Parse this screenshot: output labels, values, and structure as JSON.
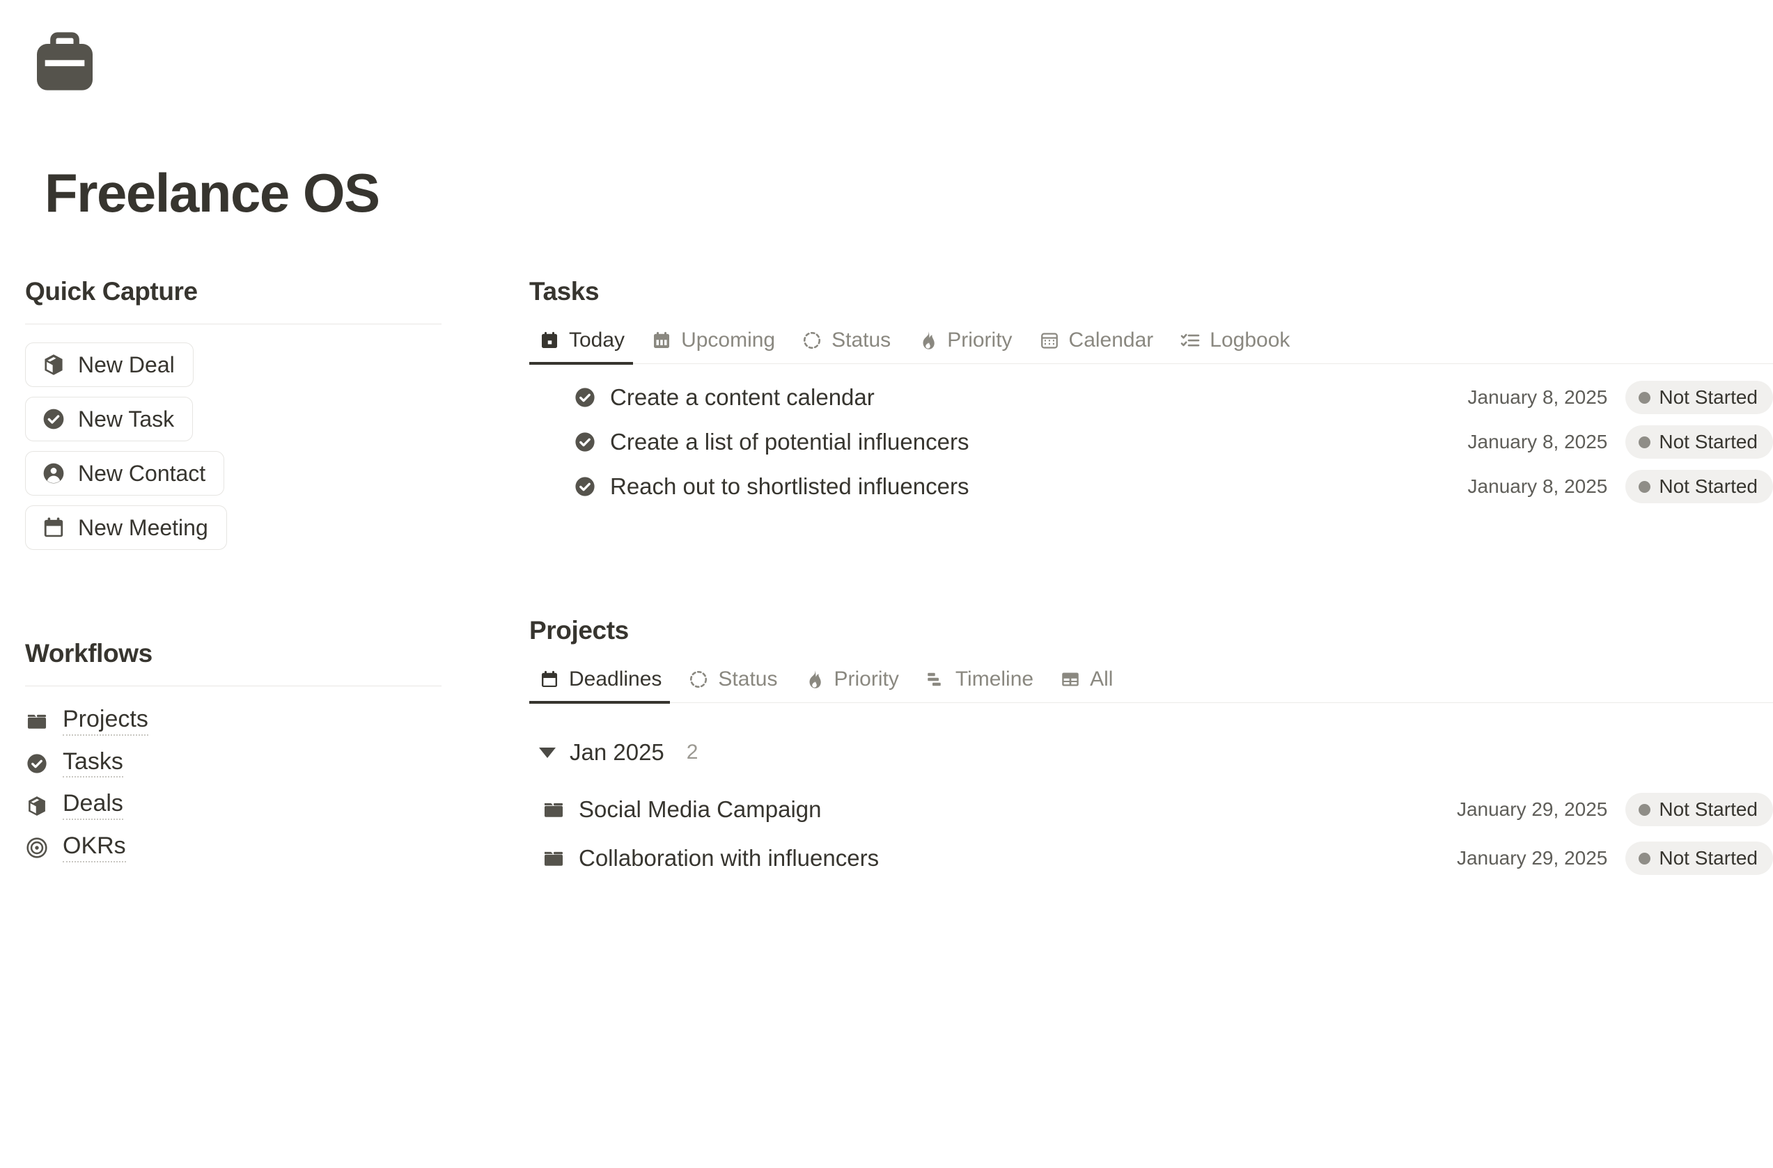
{
  "header": {
    "icon": "briefcase-icon",
    "title": "Freelance OS"
  },
  "quick_capture": {
    "heading": "Quick Capture",
    "buttons": [
      {
        "label": "New Deal",
        "icon": "package-icon"
      },
      {
        "label": "New Task",
        "icon": "check-circle-icon"
      },
      {
        "label": "New Contact",
        "icon": "person-circle-icon"
      },
      {
        "label": "New Meeting",
        "icon": "calendar-icon"
      }
    ]
  },
  "workflows": {
    "heading": "Workflows",
    "items": [
      {
        "label": "Projects",
        "icon": "folder-icon"
      },
      {
        "label": "Tasks",
        "icon": "check-circle-icon"
      },
      {
        "label": "Deals",
        "icon": "package-icon"
      },
      {
        "label": "OKRs",
        "icon": "target-icon"
      }
    ]
  },
  "tasks": {
    "heading": "Tasks",
    "tabs": [
      {
        "label": "Today",
        "icon": "calendar-today-icon",
        "active": true
      },
      {
        "label": "Upcoming",
        "icon": "calendar-upcoming-icon",
        "active": false
      },
      {
        "label": "Status",
        "icon": "dashed-circle-icon",
        "active": false
      },
      {
        "label": "Priority",
        "icon": "flame-icon",
        "active": false
      },
      {
        "label": "Calendar",
        "icon": "calendar-grid-icon",
        "active": false
      },
      {
        "label": "Logbook",
        "icon": "checklist-icon",
        "active": false
      }
    ],
    "rows": [
      {
        "title": "Create a content calendar",
        "icon": "check-circle-icon",
        "date": "January 8, 2025",
        "status": "Not Started"
      },
      {
        "title": "Create a list of potential influencers",
        "icon": "check-circle-icon",
        "date": "January 8, 2025",
        "status": "Not Started"
      },
      {
        "title": "Reach out to shortlisted influencers",
        "icon": "check-circle-icon",
        "date": "January 8, 2025",
        "status": "Not Started"
      }
    ]
  },
  "projects": {
    "heading": "Projects",
    "tabs": [
      {
        "label": "Deadlines",
        "icon": "calendar-icon",
        "active": true
      },
      {
        "label": "Status",
        "icon": "dashed-circle-icon",
        "active": false
      },
      {
        "label": "Priority",
        "icon": "flame-icon",
        "active": false
      },
      {
        "label": "Timeline",
        "icon": "gantt-icon",
        "active": false
      },
      {
        "label": "All",
        "icon": "table-icon",
        "active": false
      }
    ],
    "group": {
      "label": "Jan 2025",
      "count": "2",
      "expanded": true
    },
    "rows": [
      {
        "title": "Social Media Campaign",
        "icon": "folder-icon",
        "date": "January 29, 2025",
        "status": "Not Started"
      },
      {
        "title": "Collaboration with influencers",
        "icon": "folder-icon",
        "date": "January 29, 2025",
        "status": "Not Started"
      }
    ]
  },
  "colors": {
    "text": "#37352f",
    "muted": "#8a8880",
    "icon": "#55534c",
    "badge_bg": "#f1f0ee",
    "badge_dot": "#8f8d87",
    "rule": "#e8e7e4"
  }
}
